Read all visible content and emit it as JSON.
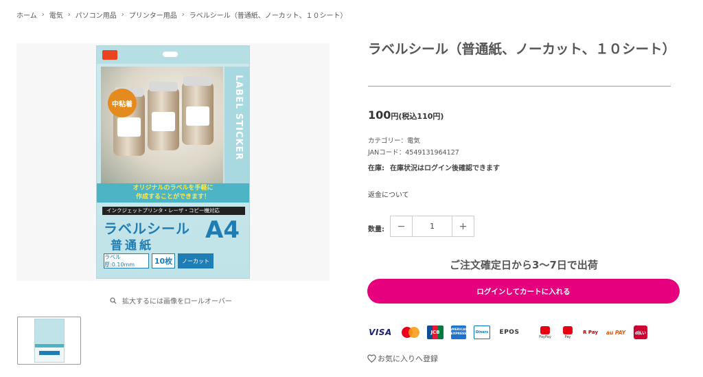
{
  "breadcrumb": {
    "items": [
      "ホーム",
      "電気",
      "パソコン用品",
      "プリンター用品",
      "ラベルシール（普通紙、ノーカット、１０シート）"
    ],
    "separator": "›"
  },
  "gallery": {
    "package": {
      "side_text": "LABEL STICKER",
      "badge": "中粘着",
      "banner_line1": "オリジナルのラベルを手軽に",
      "banner_line2": "作成することができます！",
      "strip": "インクジェットプリンタ・レーザ・コピー機対応",
      "title": "ラベルシール",
      "sub": "普通紙",
      "size": "A4",
      "chip1": "ラベル厚:0.10mm",
      "chip2": "10枚",
      "chip3": "ノーカット"
    },
    "zoom_hint": "拡大するには画像をロールオーバー"
  },
  "product": {
    "title": "ラベルシール（普通紙、ノーカット、１０シート）",
    "price": "100",
    "price_unit": "円(税込110円)",
    "category": "カテゴリー：電気",
    "jan": "JANコード：4549131964127",
    "stock_label": "在庫:",
    "stock_value": "在庫状況はログイン後確認できます",
    "refund": "返金について",
    "qty_label": "数量:",
    "qty_value": "1",
    "minus": "−",
    "plus": "+",
    "shipping": "ご注文確定日から3〜7日で出荷",
    "cart_button": "ログインしてカートに入れる",
    "favorite": "お気に入りへ登録"
  },
  "payments": {
    "visa": "VISA",
    "jcb": "JCB",
    "amex": "AMERICAN EXPRESS",
    "diners": "Diners",
    "epos": "EPOS",
    "paypay": "PayPay",
    "merpay": "Pay",
    "rpay": "R Pay",
    "aupay": "au PAY",
    "dpay": "d払い"
  },
  "colors": {
    "accent": "#e6007e",
    "text": "#555555",
    "package_blue": "#1f7db5"
  }
}
